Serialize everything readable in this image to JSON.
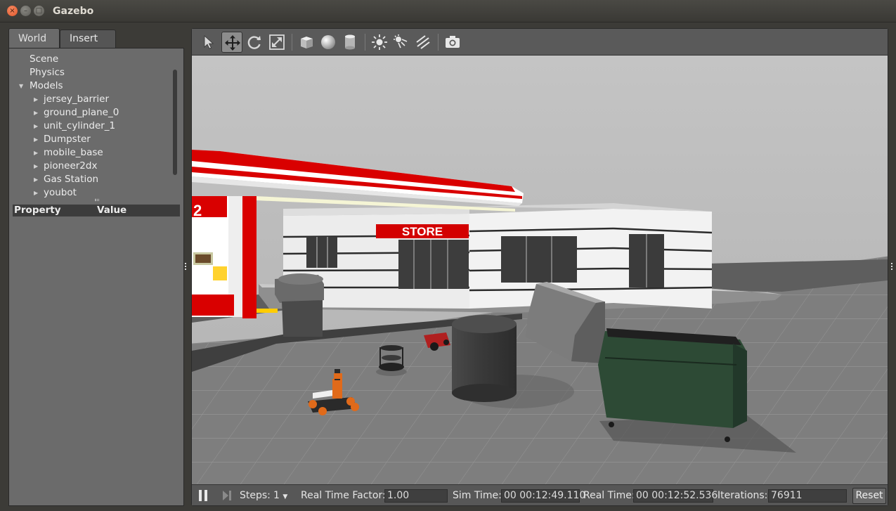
{
  "window": {
    "title": "Gazebo",
    "close_glyph": "×",
    "min_glyph": "–",
    "max_glyph": "□"
  },
  "tabs": {
    "world": "World",
    "insert": "Insert"
  },
  "tree": {
    "scene": "Scene",
    "physics": "Physics",
    "models": "Models",
    "model_items": [
      "jersey_barrier",
      "ground_plane_0",
      "unit_cylinder_1",
      "Dumpster",
      "mobile_base",
      "pioneer2dx",
      "Gas Station",
      "youbot"
    ]
  },
  "properties": {
    "col_property": "Property",
    "col_value": "Value"
  },
  "toolbar": {
    "icons": [
      "select-arrow-icon",
      "translate-icon",
      "rotate-icon",
      "scale-icon",
      "box-icon",
      "sphere-icon",
      "cylinder-icon",
      "point-light-icon",
      "spot-light-icon",
      "directional-light-icon",
      "screenshot-icon"
    ],
    "active": "translate-icon"
  },
  "scene": {
    "store_sign": "STORE",
    "canopy_number": "2"
  },
  "status": {
    "steps_label": "Steps:",
    "steps_value": "1",
    "rtf_label": "Real Time Factor:",
    "rtf_value": "1.00",
    "sim_time_label": "Sim Time:",
    "sim_time_value": "00 00:12:49.110",
    "real_time_label": "Real Time:",
    "real_time_value": "00 00:12:52.536",
    "iterations_label": "Iterations:",
    "iterations_value": "76911",
    "reset_label": "Reset"
  },
  "colors": {
    "canopy_red": "#d90000",
    "store_red": "#d30000",
    "dumpster_green": "#2d4a35",
    "ground": "#7d7d7d",
    "sky": "#b8b8b8"
  }
}
